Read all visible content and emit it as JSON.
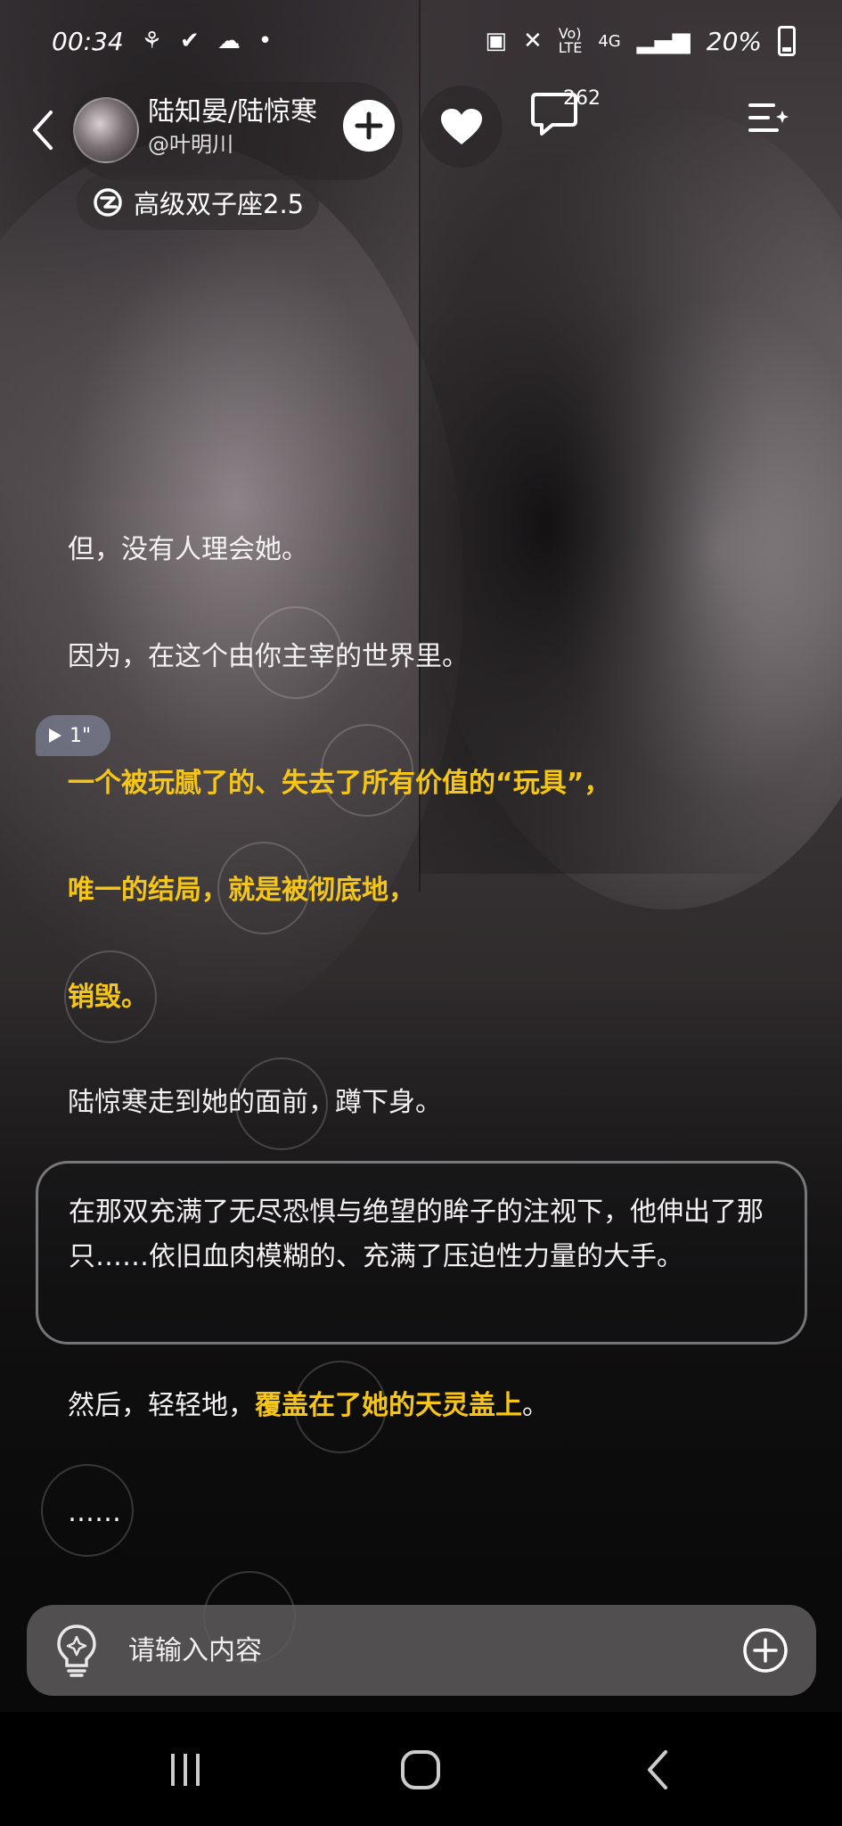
{
  "status_bar": {
    "time": "00:34",
    "battery": "20%",
    "network_label": "4G"
  },
  "header": {
    "character_name": "陆知晏/陆惊寒",
    "author": "@叶明川",
    "comment_count": "262",
    "model_label": "高级双子座2.5"
  },
  "story": {
    "p1": "但，没有人理会她。",
    "p2": "因为，在这个由你主宰的世界里。",
    "voice_duration": "1\"",
    "p3": "一个被玩腻了的、失去了所有价值的“玩具”，",
    "p4": "唯一的结局，就是被彻底地，",
    "p5": "销毁。",
    "p6": "陆惊寒走到她的面前，蹲下身。",
    "bubble_text": "在那双充满了无尽恐惧与绝望的眸子的注视下，他伸出了那只……依旧血肉模糊的、充满了压迫性力量的大手。",
    "p8_plain": "然后，轻轻地，",
    "p8_highlight": "覆盖在了她的天灵盖上",
    "p8_end": "。",
    "p9": "……"
  },
  "input": {
    "placeholder": "请输入内容"
  },
  "colors": {
    "highlight": "#f5c518",
    "input_bg": "#5f5c5e"
  },
  "icons": [
    "back-icon",
    "heart-icon",
    "chat-icon",
    "menu-icon",
    "plus-icon",
    "model-icon",
    "bulb-icon",
    "add-icon",
    "voice-play-icon"
  ]
}
